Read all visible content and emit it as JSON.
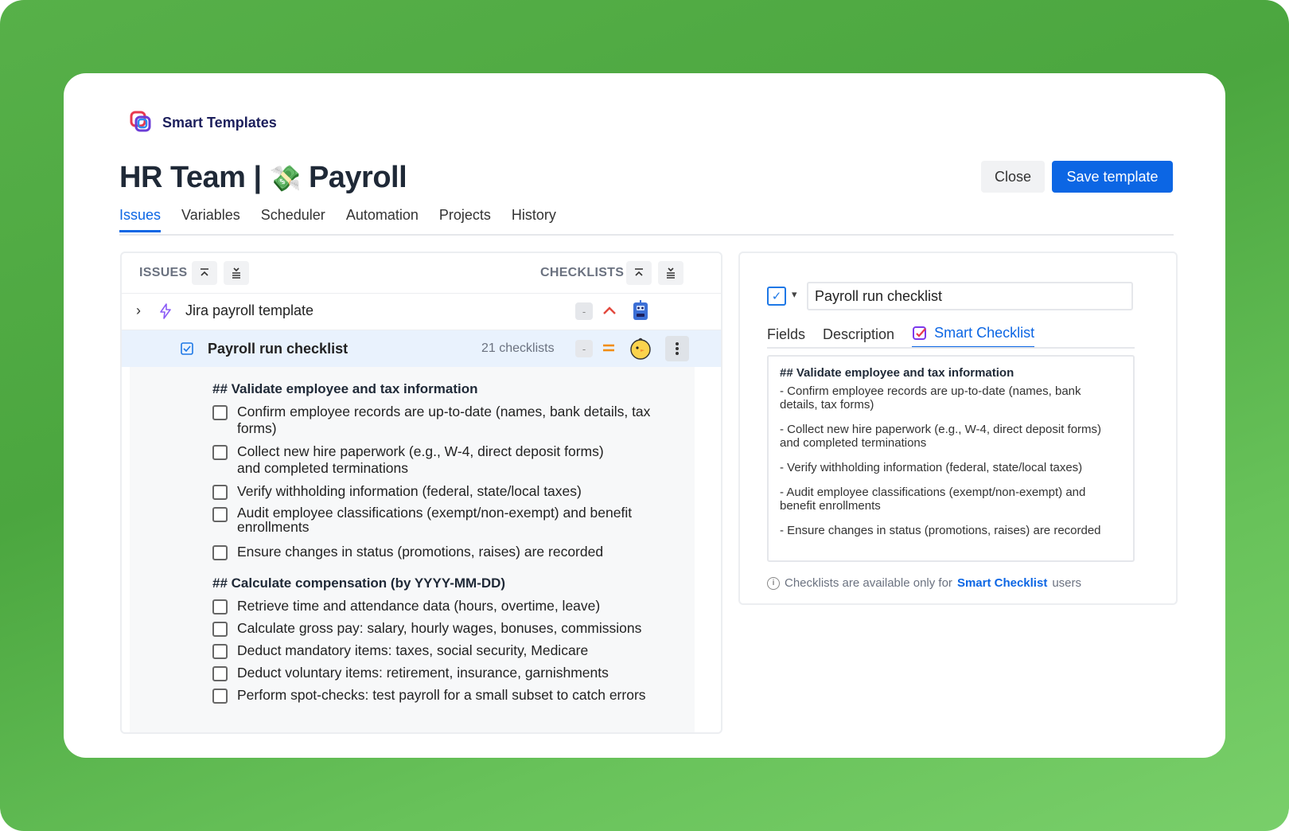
{
  "brand": {
    "name": "Smart Templates"
  },
  "header": {
    "title_prefix": "HR Team |",
    "title_emoji": "💸",
    "title_suffix": "Payroll",
    "close_label": "Close",
    "save_label": "Save template"
  },
  "tabs": [
    "Issues",
    "Variables",
    "Scheduler",
    "Automation",
    "Projects",
    "History"
  ],
  "active_tab": "Issues",
  "issues_panel": {
    "issues_label": "ISSUES",
    "checklists_label": "CHECKLISTS",
    "rows": [
      {
        "title": "Jira payroll template",
        "dash": "-",
        "priority": "^",
        "avatar": "robot"
      },
      {
        "title": "Payroll run checklist",
        "count": "21 checklists",
        "dash": "-",
        "priority": "=",
        "avatar": "chick"
      }
    ],
    "sections": [
      {
        "heading": "## Validate employee and tax information",
        "items": [
          "Confirm employee records are up-to-date (names, bank details, tax forms)",
          "Collect new hire paperwork (e.g., W-4, direct deposit forms) and completed terminations",
          "Verify withholding information (federal, state/local taxes)",
          "Audit employee classifications (exempt/non-exempt) and benefit enrollments",
          "Ensure changes in status (promotions, raises) are recorded"
        ]
      },
      {
        "heading": "## Calculate compensation (by YYYY-MM-DD)",
        "items": [
          "Retrieve time and attendance data (hours, overtime, leave)",
          "Calculate gross pay: salary, hourly wages, bonuses, commissions",
          "Deduct mandatory items: taxes, social security, Medicare",
          "Deduct voluntary items: retirement, insurance, garnishments",
          "Perform spot-checks: test payroll for a small subset to catch errors"
        ]
      }
    ]
  },
  "detail_panel": {
    "name_value": "Payroll run checklist",
    "tabs": [
      "Fields",
      "Description",
      "Smart Checklist"
    ],
    "active_tab": "Smart Checklist",
    "content_heading": "## Validate employee and tax information",
    "content_lines": [
      "- Confirm employee records are up-to-date (names, bank details, tax forms)",
      "- Collect new hire paperwork (e.g., W-4, direct deposit forms) and completed terminations",
      "- Verify withholding information (federal, state/local taxes)",
      "- Audit employee classifications (exempt/non-exempt) and benefit enrollments",
      "- Ensure changes in status (promotions, raises) are recorded"
    ],
    "note_prefix": "Checklists are available only for",
    "note_link": "Smart Checklist",
    "note_suffix": "users"
  },
  "colors": {
    "accent": "#0c66e4",
    "background": "#57b049",
    "priority_high": "#e2483d",
    "priority_medium": "#f18d13"
  }
}
